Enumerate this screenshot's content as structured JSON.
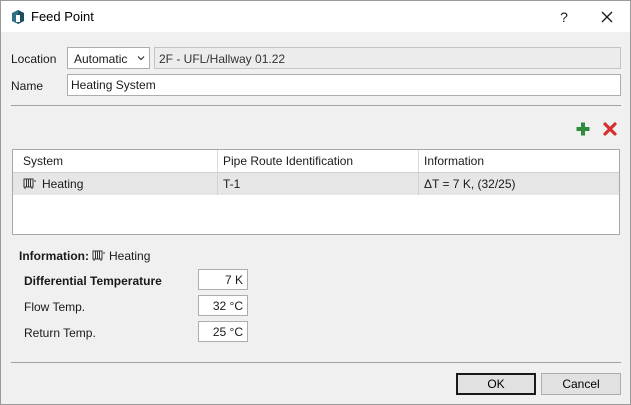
{
  "window": {
    "title": "Feed Point",
    "help_label": "?"
  },
  "form": {
    "location_label": "Location",
    "location_mode": "Automatic",
    "location_value": "2F - UFL/Hallway 01.22",
    "name_label": "Name",
    "name_value": "Heating System"
  },
  "table": {
    "columns": [
      "System",
      "Pipe Route Identification",
      "Information"
    ],
    "rows": [
      {
        "system": "Heating",
        "route": "T-1",
        "info": "ΔT = 7 K, (32/25)"
      }
    ]
  },
  "information": {
    "label": "Information:",
    "system": "Heating",
    "properties": [
      {
        "label": "Differential Temperature",
        "value": "7 K"
      },
      {
        "label": "Flow Temp.",
        "value": "32 °C"
      },
      {
        "label": "Return Temp.",
        "value": "25 °C"
      }
    ]
  },
  "buttons": {
    "ok": "OK",
    "cancel": "Cancel"
  },
  "colors": {
    "add": "#2e8b3e",
    "delete": "#d83030",
    "selected_row": "#e6e6e6"
  }
}
